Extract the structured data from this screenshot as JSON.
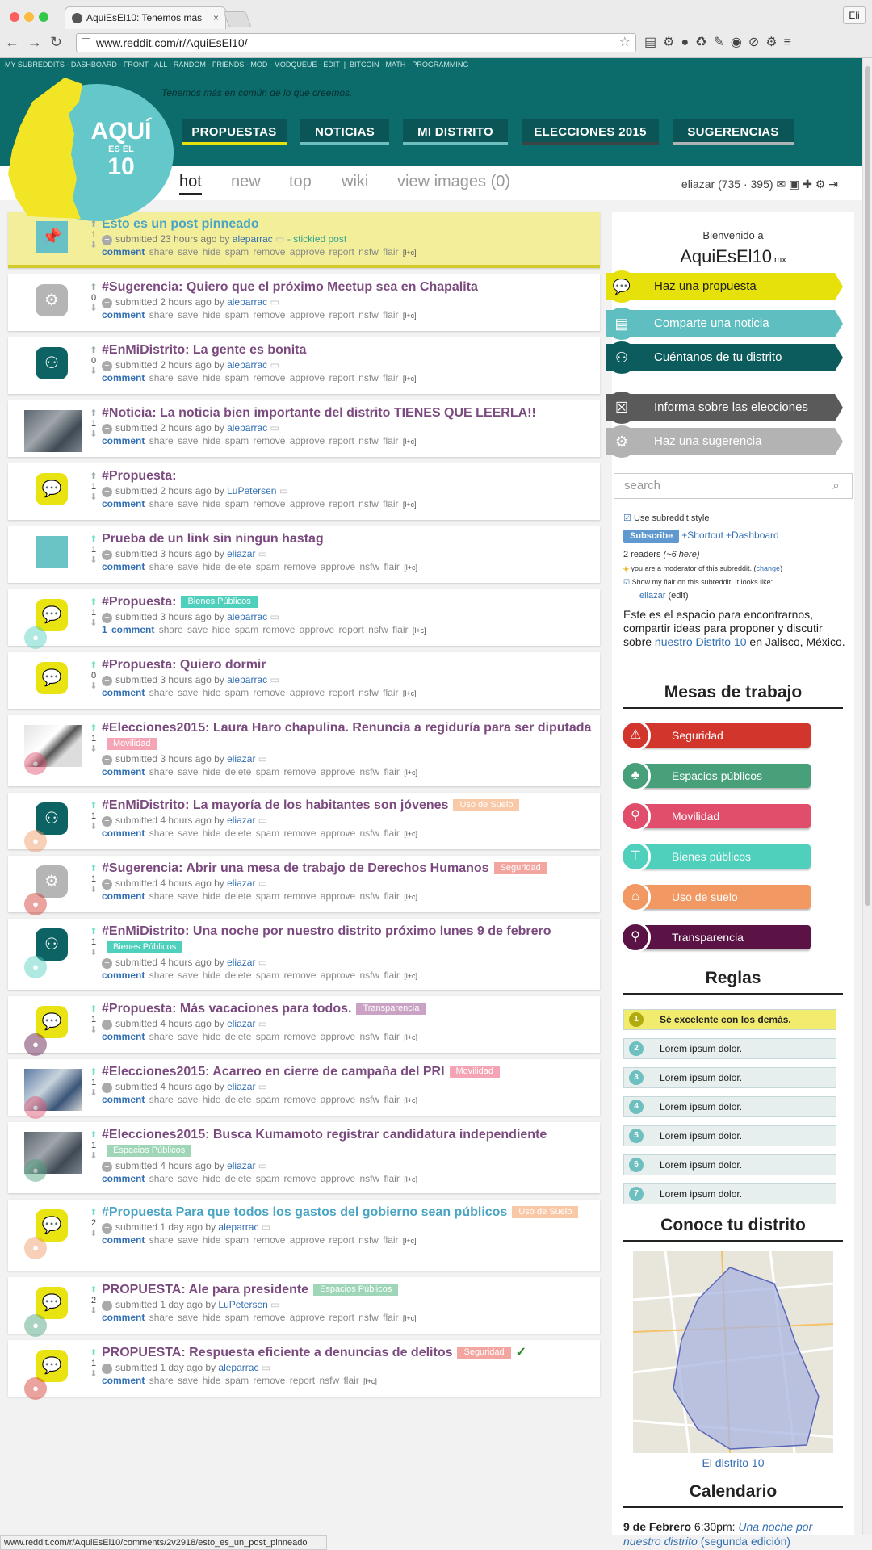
{
  "browser": {
    "tab_title": "AquiEsEl10: Tenemos más",
    "url": "www.reddit.com/r/AquiEsEl10/",
    "user": "Eli",
    "status_url": "www.reddit.com/r/AquiEsEl10/comments/2v2918/esto_es_un_post_pinneado"
  },
  "srbar": {
    "left": "MY SUBREDDITS - DASHBOARD - FRONT - ALL - RANDOM - FRIENDS - MOD - MODQUEUE - EDIT",
    "right": "BITCOIN - MATH - PROGRAMMING"
  },
  "header": {
    "tagline": "Tenemos más en común de lo que creemos.",
    "logo_top": "AQUÍ",
    "logo_mid": "ES EL",
    "logo_num": "10",
    "nav": [
      "PROPUESTAS",
      "NOTICIAS",
      "MI DISTRITO",
      "ELECCIONES 2015",
      "SUGERENCIAS"
    ],
    "sort_tabs": [
      "hot",
      "new",
      "top",
      "wiki",
      "view images (0)"
    ],
    "username": "eliazar",
    "karma": "(735 · 395)"
  },
  "colors": {
    "teal": "#0c6b6b",
    "yellow": "#e7e10b",
    "post_title": "#7b4b7f",
    "link": "#336fb3"
  },
  "posts": [
    {
      "title": "Esto es un post pinneado",
      "score": "1",
      "flair": "",
      "time": "submitted 23 hours ago by",
      "author": "aleparrac",
      "extra": "- stickied post",
      "buttons": "share save hide spam remove approve report nsfw flair",
      "comment": "comment",
      "icon": "pin-icon"
    },
    {
      "title": "#Sugerencia: Quiero que el próximo Meetup sea en Chapalita",
      "score": "0",
      "flair": "",
      "time": "submitted 2 hours ago by",
      "author": "aleparrac",
      "extra": "",
      "buttons": "share save hide spam remove approve report nsfw flair",
      "comment": "comment",
      "icon": "gear-icon"
    },
    {
      "title": "#EnMiDistrito: La gente es bonita",
      "score": "0",
      "flair": "",
      "time": "submitted 2 hours ago by",
      "author": "aleparrac",
      "extra": "",
      "buttons": "share save hide spam remove approve report nsfw flair",
      "comment": "comment",
      "icon": "people-icon"
    },
    {
      "title": "#Noticia: La noticia bien importante del distrito TIENES QUE LEERLA!!",
      "score": "1",
      "flair": "",
      "time": "submitted 2 hours ago by",
      "author": "aleparrac",
      "extra": "",
      "buttons": "share save hide spam remove approve report nsfw flair",
      "comment": "comment",
      "icon": "photo-thumbnail"
    },
    {
      "title": "#Propuesta:",
      "score": "1",
      "flair": "",
      "time": "submitted 2 hours ago by",
      "author": "LuPetersen",
      "extra": "",
      "buttons": "share save hide spam remove approve report nsfw flair",
      "comment": "comment",
      "icon": "speech-bubble-icon"
    },
    {
      "title": "Prueba de un link sin ningun hastag",
      "score": "1",
      "flair": "",
      "time": "submitted 3 hours ago by",
      "author": "eliazar",
      "extra": "",
      "buttons": "share save hide delete spam remove approve nsfw flair",
      "comment": "comment",
      "icon": "chat-icon"
    },
    {
      "title": "#Propuesta:",
      "score": "1",
      "flair": "Bienes Públicos",
      "time": "submitted 3 hours ago by",
      "author": "aleparrac",
      "extra": "",
      "buttons": "share save hide spam remove approve report nsfw flair",
      "comment": "1 comment",
      "icon": "speech-bubble-icon"
    },
    {
      "title": "#Propuesta: Quiero dormir",
      "score": "0",
      "flair": "",
      "time": "submitted 3 hours ago by",
      "author": "aleparrac",
      "extra": "",
      "buttons": "share save hide spam remove approve report nsfw flair",
      "comment": "comment",
      "icon": "speech-bubble-icon"
    },
    {
      "title": "#Elecciones2015: Laura Haro chapulina. Renuncia a regiduría para ser diputada",
      "score": "1",
      "flair": "Movilidad",
      "time": "submitted 3 hours ago by",
      "author": "eliazar",
      "extra": "",
      "buttons": "share save hide delete spam remove approve nsfw flair",
      "comment": "comment",
      "icon": "photo-thumbnail"
    },
    {
      "title": "#EnMiDistrito: La mayoría de los habitantes son jóvenes",
      "score": "1",
      "flair": "Uso de Suelo",
      "time": "submitted 4 hours ago by",
      "author": "eliazar",
      "extra": "",
      "buttons": "share save hide delete spam remove approve nsfw flair",
      "comment": "comment",
      "icon": "people-icon"
    },
    {
      "title": "#Sugerencia: Abrir una mesa de trabajo de Derechos Humanos",
      "score": "1",
      "flair": "Seguridad",
      "time": "submitted 4 hours ago by",
      "author": "eliazar",
      "extra": "",
      "buttons": "share save hide delete spam remove approve nsfw flair",
      "comment": "comment",
      "icon": "gear-icon"
    },
    {
      "title": "#EnMiDistrito: Una noche por nuestro distrito próximo lunes 9 de febrero",
      "score": "1",
      "flair": "Bienes Públicos",
      "time": "submitted 4 hours ago by",
      "author": "eliazar",
      "extra": "",
      "buttons": "share save hide delete spam remove approve nsfw flair",
      "comment": "comment",
      "icon": "people-icon"
    },
    {
      "title": "#Propuesta: Más vacaciones para todos.",
      "score": "1",
      "flair": "Transparencia",
      "time": "submitted 4 hours ago by",
      "author": "eliazar",
      "extra": "",
      "buttons": "share save hide delete spam remove approve nsfw flair",
      "comment": "comment",
      "icon": "speech-bubble-icon"
    },
    {
      "title": "#Elecciones2015: Acarreo en cierre de campaña del PRI",
      "score": "1",
      "flair": "Movilidad",
      "time": "submitted 4 hours ago by",
      "author": "eliazar",
      "extra": "",
      "buttons": "share save hide delete spam remove approve nsfw flair",
      "comment": "comment",
      "icon": "photo-thumbnail"
    },
    {
      "title": "#Elecciones2015: Busca Kumamoto registrar candidatura independiente",
      "score": "1",
      "flair": "Espacios Públicos",
      "time": "submitted 4 hours ago by",
      "author": "eliazar",
      "extra": "",
      "buttons": "share save hide delete spam remove approve nsfw flair",
      "comment": "comment",
      "icon": "photo-thumbnail"
    },
    {
      "title": "#Propuesta Para que todos los gastos del gobierno sean públicos",
      "score": "2",
      "flair": "Uso de Suelo",
      "time": "submitted 1 day ago by",
      "author": "aleparrac",
      "extra": "",
      "buttons": "share save hide spam remove approve report nsfw flair",
      "comment": "comment",
      "icon": "speech-bubble-icon"
    },
    {
      "title": "PROPUESTA: Ale para presidente",
      "score": "2",
      "flair": "Espacios Públicos",
      "time": "submitted 1 day ago by",
      "author": "LuPetersen",
      "extra": "",
      "buttons": "share save hide spam remove approve report nsfw flair",
      "comment": "comment",
      "icon": "speech-bubble-icon"
    },
    {
      "title": "PROPUESTA: Respuesta eficiente a denuncias de delitos",
      "score": "1",
      "flair": "Seguridad",
      "time": "submitted 1 day ago by",
      "author": "aleparrac",
      "extra": "",
      "buttons": "share save hide spam remove report nsfw flair",
      "comment": "comment",
      "icon": "speech-bubble-icon"
    }
  ],
  "sidebar": {
    "welcome": "Bienvenido a",
    "site": "AquiEsEl10",
    "site_suffix": ".mx",
    "ctas": [
      "Haz una propuesta",
      "Comparte una noticia",
      "Cuéntanos de tu distrito",
      "Informa sobre las elecciones",
      "Haz una sugerencia"
    ],
    "search_placeholder": "search",
    "use_style": "Use subreddit style",
    "subscribe": "Subscribe",
    "shortcut": "+Shortcut",
    "dashboard": "+Dashboard",
    "readers": "2 readers",
    "here": "(~6 here)",
    "moderator": "you are a moderator of this subreddit.",
    "change": "change",
    "flair_note": "Show my flair on this subreddit. It looks like:",
    "flair_user": "eliazar",
    "edit": "edit",
    "desc1": "Este es el espacio para encontrarnos, compartir ideas para proponer y discutir sobre",
    "desc_link": "nuestro Distrito 10",
    "desc2": "en Jalisco, México.",
    "mesas_title": "Mesas de trabajo",
    "mesas": [
      "Seguridad",
      "Espacios públicos",
      "Movilidad",
      "Bienes públicos",
      "Uso de suelo",
      "Transparencia"
    ],
    "reglas_title": "Reglas",
    "reglas": [
      "Sé excelente con los demás.",
      "Lorem ipsum dolor.",
      "Lorem ipsum dolor.",
      "Lorem ipsum dolor.",
      "Lorem ipsum dolor.",
      "Lorem ipsum dolor.",
      "Lorem ipsum dolor."
    ],
    "distrito_title": "Conoce tu distrito",
    "map_link": "El distrito 10",
    "cal_title": "Calendario",
    "cal_date": "9 de Febrero",
    "cal_time": "6:30pm:",
    "cal_event": "Una noche por nuestro distrito",
    "cal_edition": "(segunda edición)"
  }
}
